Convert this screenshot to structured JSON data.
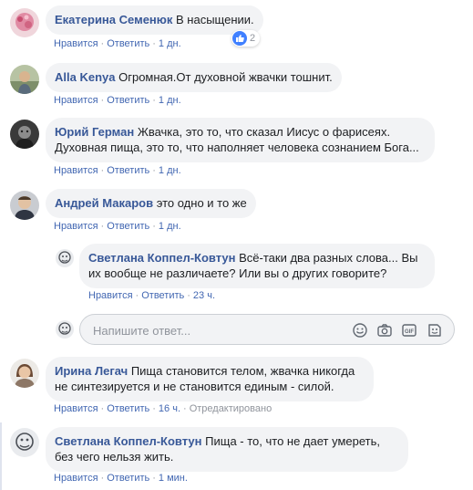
{
  "comments": [
    {
      "author": "Екатерина Семенюк",
      "text": "В насыщении.",
      "like": "Нравится",
      "reply": "Ответить",
      "time": "1 дн.",
      "reactions": "2"
    },
    {
      "author": "Alla Kenya",
      "text": "Огромная.От духовной жвачки тошнит.",
      "like": "Нравится",
      "reply": "Ответить",
      "time": "1 дн."
    },
    {
      "author": "Юрий Герман",
      "text": "Жвачка, это то, что сказал Иисус о фарисеях. Духовная пища, это то, что наполняет человека сознанием Бога...",
      "like": "Нравится",
      "reply": "Ответить",
      "time": "1 дн."
    },
    {
      "author": "Андрей Макаров",
      "text": "это одно и то же",
      "like": "Нравится",
      "reply": "Ответить",
      "time": "1 дн."
    },
    {
      "author": "Ирина Легач",
      "text": "Пища становится телом, жвачка никогда не синтезируется и не становится единым - силой.",
      "like": "Нравится",
      "reply": "Ответить",
      "time": "16 ч.",
      "edited": "Отредактировано"
    },
    {
      "author": "Светлана Коппел-Ковтун",
      "text": "Пища - то, что не дает умереть, без чего нельзя жить.",
      "like": "Нравится",
      "reply": "Ответить",
      "time": "1 мин."
    }
  ],
  "reply": {
    "author": "Светлана Коппел-Ковтун",
    "text": "Всё-таки два разных слова... Вы их вообще не различаете? Или вы о других говорите?",
    "like": "Нравится",
    "reply": "Ответить",
    "time": "23 ч."
  },
  "reply_input": {
    "placeholder": "Напишите ответ..."
  },
  "colors": {
    "name": "#385898",
    "link": "#4267b2",
    "meta": "#90949c",
    "bubble": "#f2f3f5",
    "like_badge": "#4080ff"
  },
  "icons": [
    "like-icon",
    "emoji-icon",
    "camera-icon",
    "gif-icon",
    "sticker-icon"
  ]
}
